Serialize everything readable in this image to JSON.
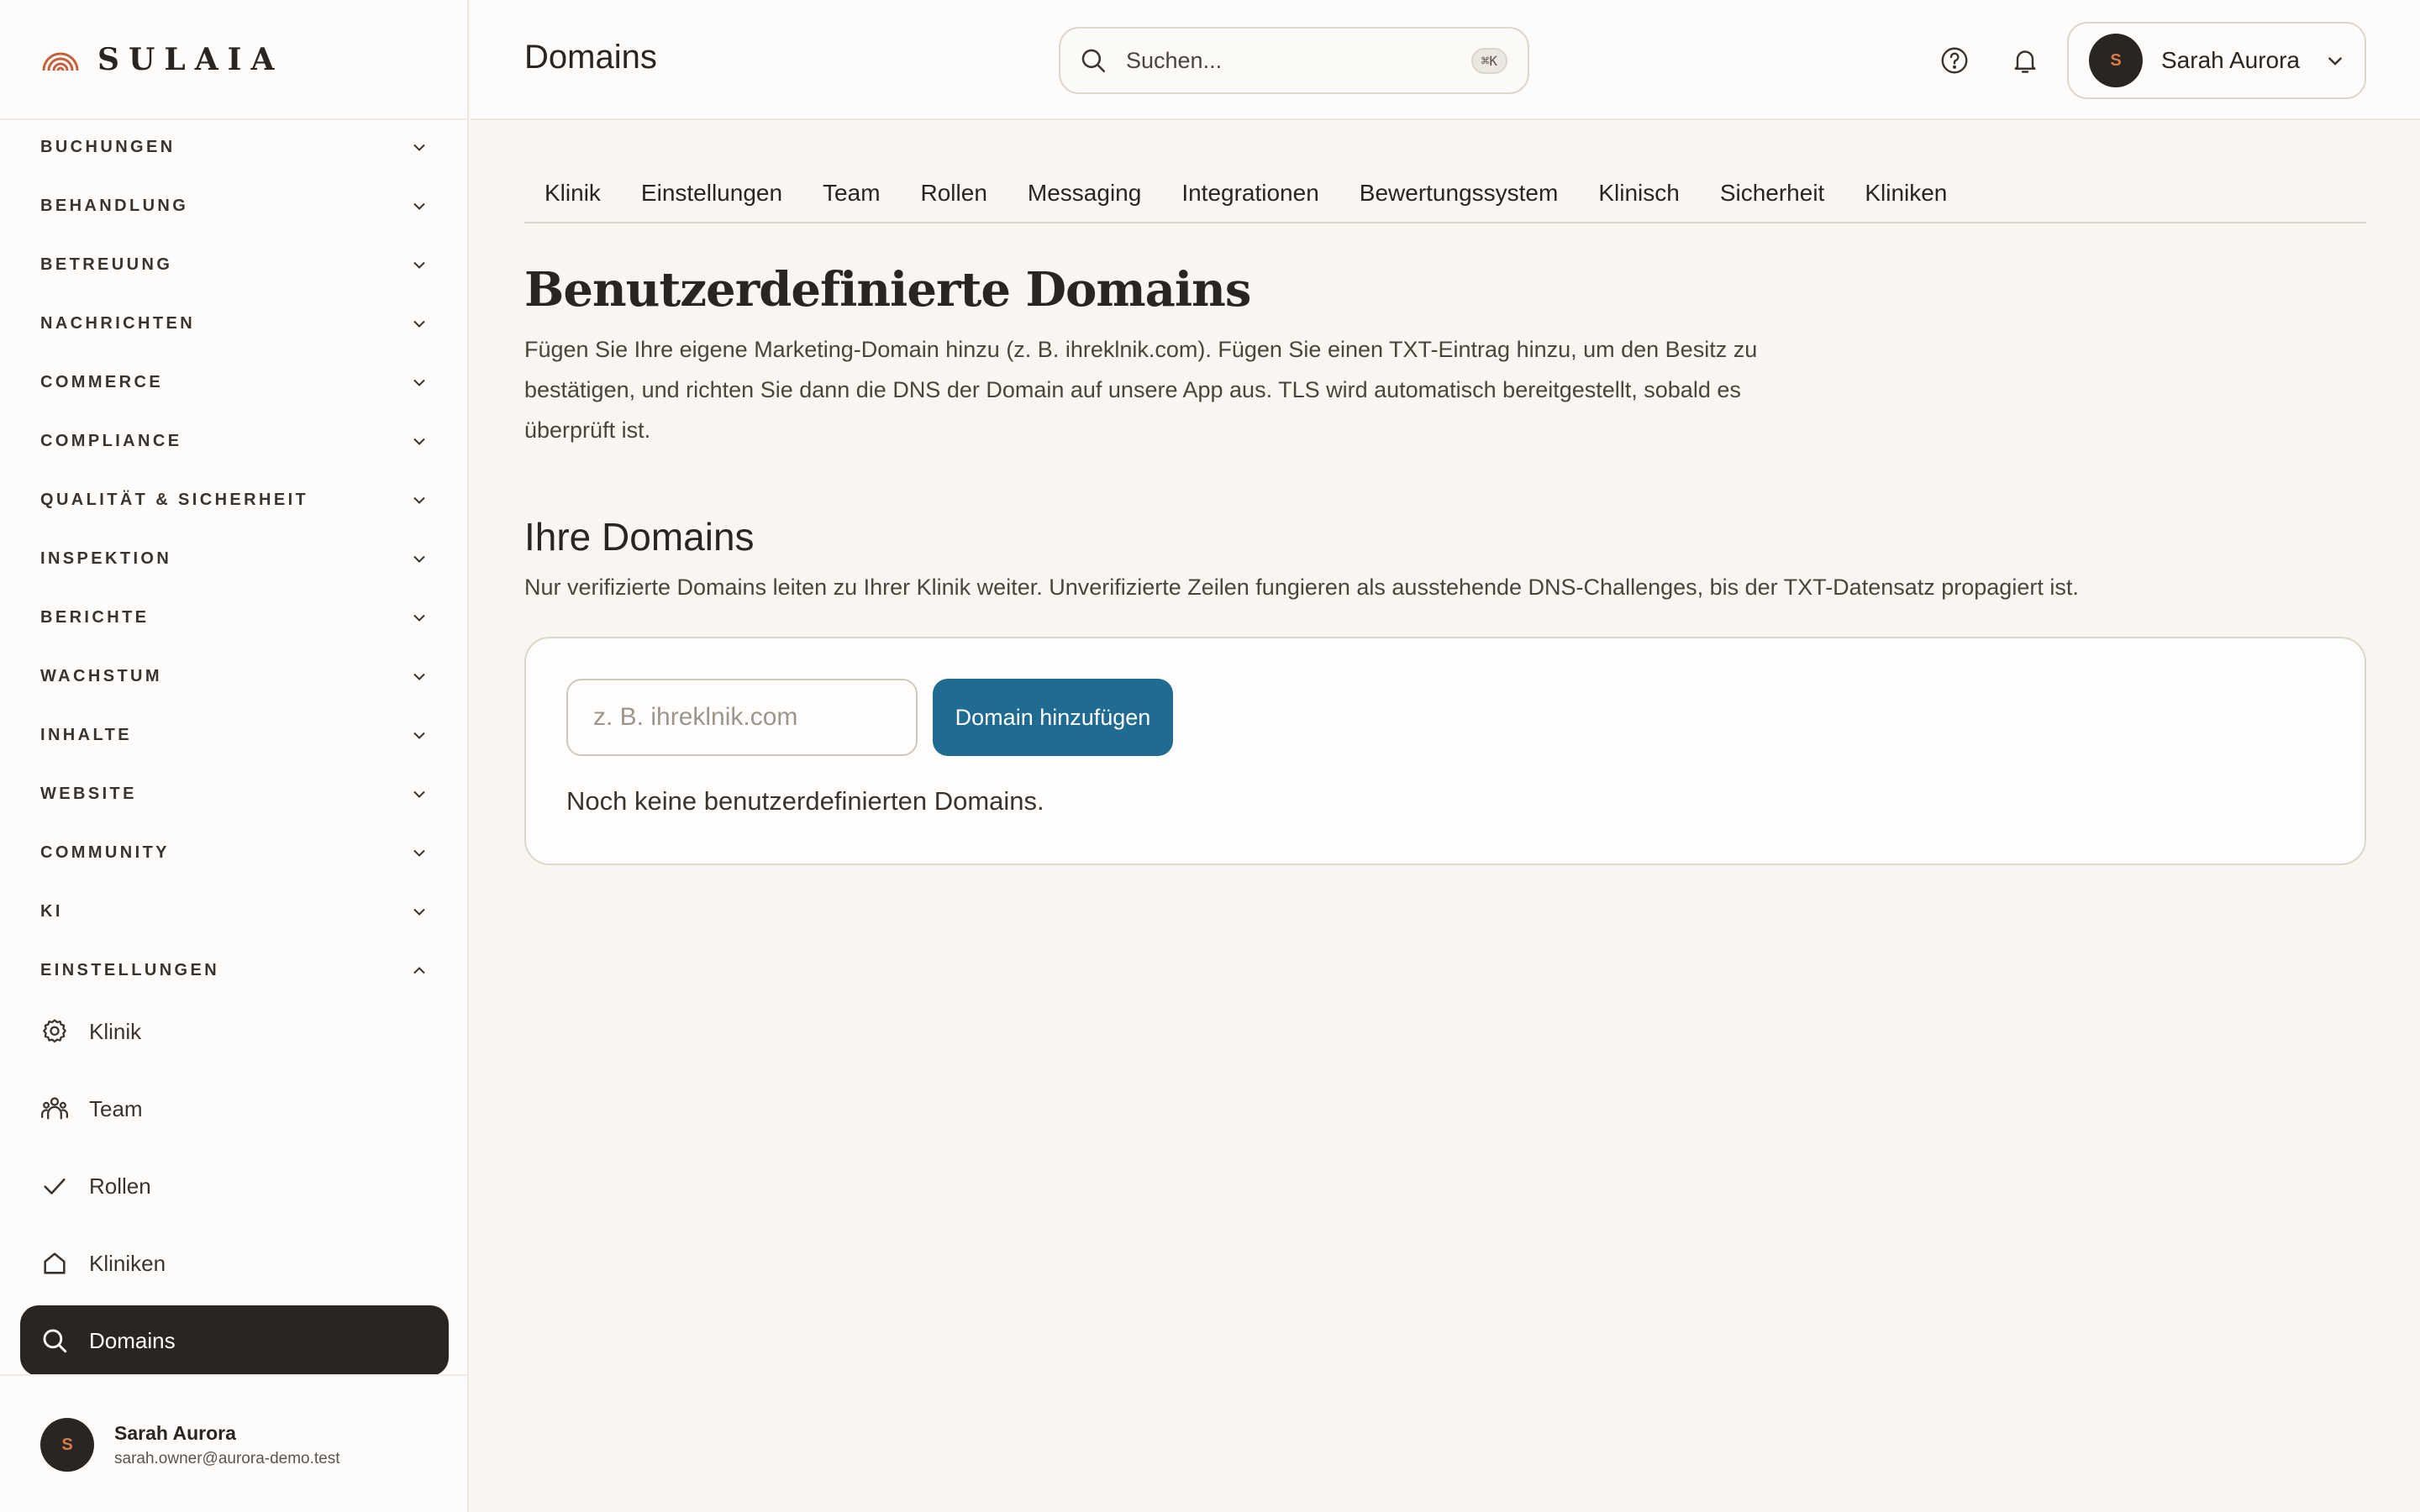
{
  "brand": {
    "name": "SULAIA",
    "accent": "#c5603a"
  },
  "sidebar": {
    "sections": [
      {
        "label": "BUCHUNGEN"
      },
      {
        "label": "BEHANDLUNG"
      },
      {
        "label": "BETREUUNG"
      },
      {
        "label": "NACHRICHTEN"
      },
      {
        "label": "COMMERCE"
      },
      {
        "label": "COMPLIANCE"
      },
      {
        "label": "QUALITÄT & SICHERHEIT"
      },
      {
        "label": "INSPEKTION"
      },
      {
        "label": "BERICHTE"
      },
      {
        "label": "WACHSTUM"
      },
      {
        "label": "INHALTE"
      },
      {
        "label": "WEBSITE"
      },
      {
        "label": "COMMUNITY"
      },
      {
        "label": "KI"
      },
      {
        "label": "EINSTELLUNGEN",
        "expanded": true
      }
    ],
    "items": [
      {
        "label": "Klinik",
        "icon": "gear-icon"
      },
      {
        "label": "Team",
        "icon": "users-icon"
      },
      {
        "label": "Rollen",
        "icon": "check-icon"
      },
      {
        "label": "Kliniken",
        "icon": "home-icon"
      },
      {
        "label": "Domains",
        "icon": "search-icon",
        "active": true
      }
    ],
    "user": {
      "initial": "S",
      "name": "Sarah Aurora",
      "email": "sarah.owner@aurora-demo.test"
    }
  },
  "header": {
    "title": "Domains",
    "search": {
      "placeholder": "Suchen...",
      "shortcut": "⌘K"
    },
    "user": {
      "initial": "S",
      "name": "Sarah Aurora"
    }
  },
  "tabs": [
    "Klinik",
    "Einstellungen",
    "Team",
    "Rollen",
    "Messaging",
    "Integrationen",
    "Bewertungssystem",
    "Klinisch",
    "Sicherheit",
    "Kliniken"
  ],
  "main": {
    "heading": "Benutzerdefinierte Domains",
    "intro_lines": [
      "Fügen Sie Ihre eigene Marketing-Domain hinzu (z. B. ihreklnik.com). Fügen Sie einen TXT-Eintrag hinzu, um den Besitz zu",
      "bestätigen, und richten Sie dann die DNS der Domain auf unsere App aus. TLS wird automatisch bereitgestellt, sobald es",
      "überprüft ist."
    ],
    "section_title": "Ihre Domains",
    "section_desc": "Nur verifizierte Domains leiten zu Ihrer Klinik weiter. Unverifizierte Zeilen fungieren als ausstehende DNS-Challenges, bis der TXT-Datensatz propagiert ist.",
    "domain_input": {
      "placeholder": "z. B. ihreklnik.com",
      "value": ""
    },
    "add_button": "Domain hinzufügen",
    "empty_state": "Noch keine benutzerdefinierten Domains.",
    "colors": {
      "primary_button": "#1f6b91",
      "active_nav": "#2a2521"
    }
  }
}
